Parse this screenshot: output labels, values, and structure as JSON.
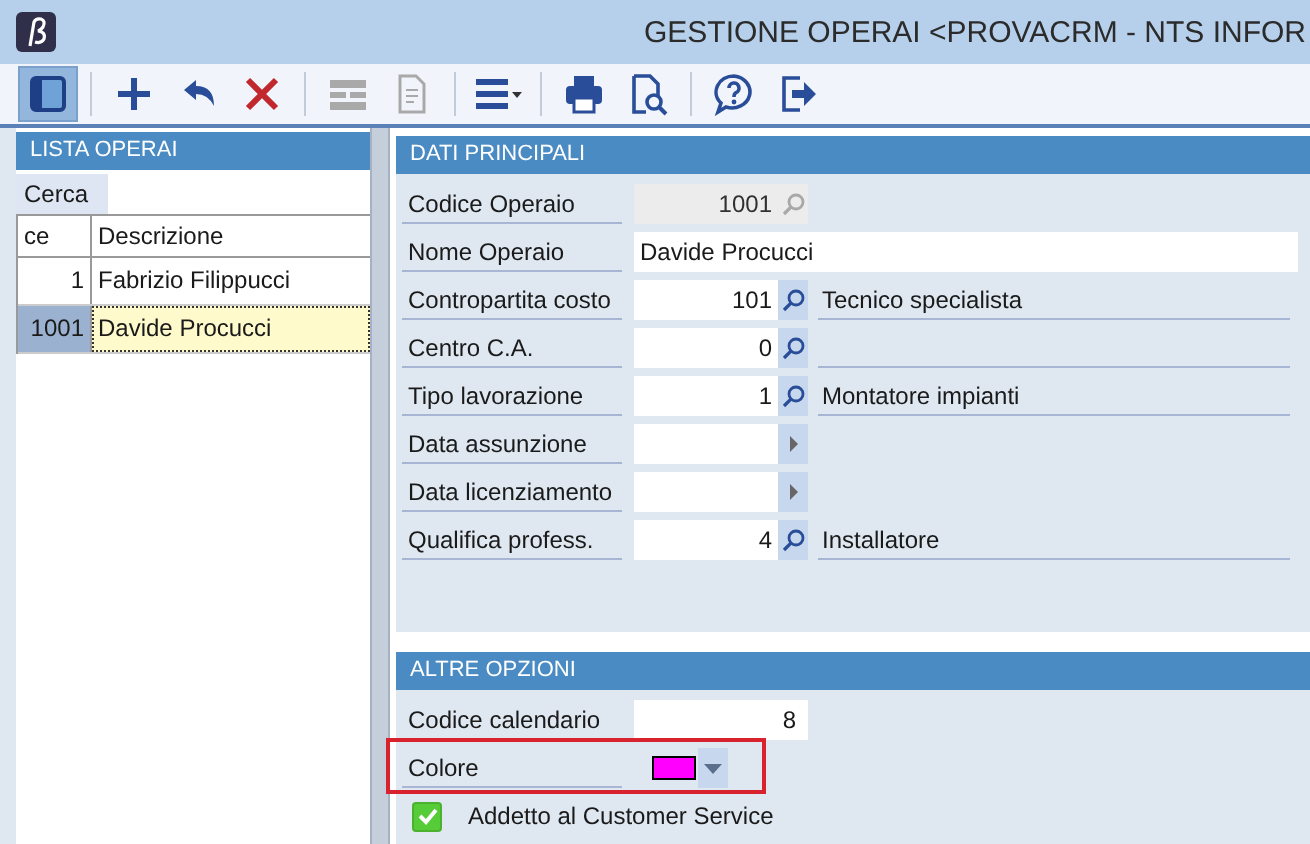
{
  "window": {
    "title": "GESTIONE OPERAI <PROVACRM - NTS INFOR"
  },
  "toolbar": [
    {
      "kind": "panel",
      "selected": true,
      "disabled": false
    },
    {
      "kind": "separator"
    },
    {
      "kind": "add",
      "selected": false,
      "disabled": false
    },
    {
      "kind": "undo",
      "selected": false,
      "disabled": false
    },
    {
      "kind": "delete",
      "selected": false,
      "disabled": false
    },
    {
      "kind": "separator"
    },
    {
      "kind": "grid",
      "selected": false,
      "disabled": true
    },
    {
      "kind": "document",
      "selected": false,
      "disabled": true
    },
    {
      "kind": "separator"
    },
    {
      "kind": "menu",
      "selected": false,
      "disabled": false
    },
    {
      "kind": "separator"
    },
    {
      "kind": "print",
      "selected": false,
      "disabled": false
    },
    {
      "kind": "preview",
      "selected": false,
      "disabled": false
    },
    {
      "kind": "separator"
    },
    {
      "kind": "help",
      "selected": false,
      "disabled": false
    },
    {
      "kind": "exit",
      "selected": false,
      "disabled": false
    }
  ],
  "list_panel": {
    "title": "LISTA OPERAI",
    "search_label": "Cerca",
    "columns": [
      "ce",
      "Descrizione"
    ],
    "rows": [
      {
        "cells": [
          "1",
          "Fabrizio Filippucci"
        ],
        "selected": false
      },
      {
        "cells": [
          "1001",
          "Davide Procucci"
        ],
        "selected": true
      }
    ]
  },
  "sections": [
    {
      "title": "DATI PRINCIPALI",
      "fields": [
        {
          "kind": "lookup",
          "label": "Codice Operaio",
          "value": "1001",
          "disabled": true
        },
        {
          "kind": "text",
          "label": "Nome Operaio",
          "value": "Davide Procucci",
          "disabled": false
        },
        {
          "kind": "lookup",
          "label": "Contropartita costo",
          "value": "101",
          "description": "Tecnico specialista",
          "disabled": false
        },
        {
          "kind": "lookup",
          "label": "Centro C.A.",
          "value": "0",
          "disabled": false
        },
        {
          "kind": "lookup",
          "label": "Tipo lavorazione",
          "value": "1",
          "description": "Montatore impianti",
          "disabled": false
        },
        {
          "kind": "date",
          "label": "Data assunzione",
          "disabled": false
        },
        {
          "kind": "date",
          "label": "Data licenziamento",
          "disabled": false
        },
        {
          "kind": "lookup",
          "label": "Qualifica profess.",
          "value": "4",
          "description": "Installatore",
          "disabled": false
        }
      ]
    },
    {
      "title": "ALTRE OPZIONI",
      "fields": [
        {
          "kind": "number",
          "label": "Codice calendario",
          "value": "8",
          "highlighted": false
        },
        {
          "kind": "color",
          "label": "Colore",
          "color": "#ff00ff",
          "highlighted": true
        },
        {
          "kind": "checkbox",
          "label": "Addetto al Customer Service",
          "checked": true,
          "highlighted": false
        }
      ]
    }
  ]
}
